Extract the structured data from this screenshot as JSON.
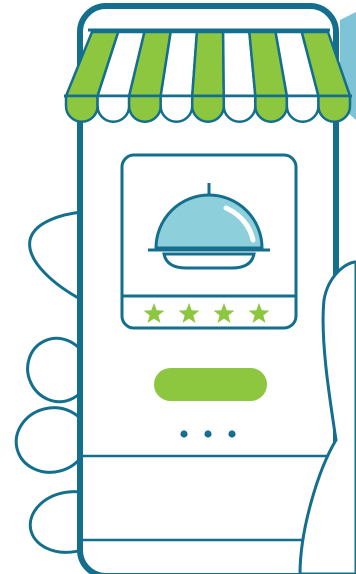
{
  "colors": {
    "outline": "#136f8d",
    "awning_green": "#8dc63f",
    "cloche_blue": "#8ecfdc",
    "accent_blue": "#7fc3d6",
    "star_green": "#8dc63f",
    "button_green": "#8dc63f",
    "background": "#ffffff"
  },
  "rating": {
    "stars": 4,
    "max": 4
  },
  "pagination": {
    "dots": 3
  },
  "icons": [
    "awning-icon",
    "cloche-icon",
    "star-icon",
    "hand-icon"
  ]
}
